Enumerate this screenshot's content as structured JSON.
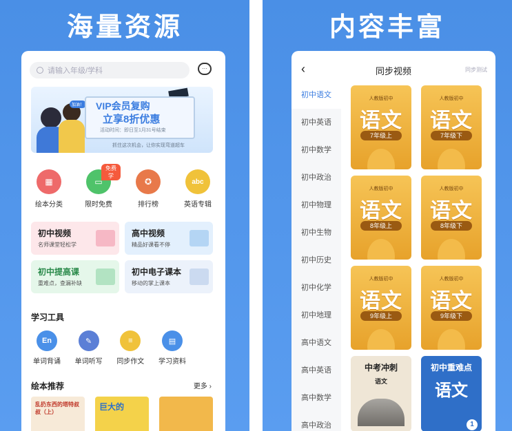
{
  "left": {
    "hero_title": "海量资源",
    "search_placeholder": "请输入年级/学科",
    "chat_icon_label": "···",
    "banner": {
      "line1": "VIP会员复购",
      "line2": "立享8折优惠",
      "line3": "活动时间：即日至1月31号结束",
      "line4": "抓住这次机会，让你实现弯道超车",
      "bubble": "加油！"
    },
    "categories": [
      {
        "label": "绘本分类",
        "color": "#ee6a6a",
        "glyph": "▦"
      },
      {
        "label": "限时免费",
        "color": "#4fc36a",
        "glyph": "▭",
        "tag": "免费学"
      },
      {
        "label": "排行榜",
        "color": "#e8794a",
        "glyph": "✪"
      },
      {
        "label": "英语专辑",
        "color": "#f0c23a",
        "glyph": "abc"
      }
    ],
    "cards": [
      {
        "title": "初中视频",
        "sub": "名师课堂轻松学",
        "bg": "#fde7ea",
        "deco": "#f08aa0"
      },
      {
        "title": "高中视频",
        "sub": "精品好课看不停",
        "bg": "#e3f0fd",
        "deco": "#86b9ec"
      },
      {
        "title": "初中提高课",
        "sub": "重难点，查漏补缺",
        "bg": "#e5f7ea",
        "deco": "#7fd09a"
      },
      {
        "title": "初中电子课本",
        "sub": "移动的掌上课本",
        "bg": "#ecf2fb",
        "deco": "#a9c1e5"
      }
    ],
    "tools_title": "学习工具",
    "tools": [
      {
        "label": "单词背诵",
        "color": "#4a90e8",
        "glyph": "En"
      },
      {
        "label": "单词听写",
        "color": "#5b7fd6",
        "glyph": "✎"
      },
      {
        "label": "同步作文",
        "color": "#f0c23a",
        "glyph": "≡"
      },
      {
        "label": "学习资料",
        "color": "#4a90e8",
        "glyph": "▤"
      }
    ],
    "books_title": "绘本推荐",
    "more": "更多 ›",
    "books": [
      {
        "title": "乱扔东西的塔特叔叔（上）",
        "bg": "#f7ead8",
        "fg": "#c0392b"
      },
      {
        "title": "巨大的",
        "bg": "#f4d24a",
        "fg": "#2a6fc9"
      },
      {
        "title": "",
        "bg": "#f2b84b",
        "fg": "#333"
      }
    ]
  },
  "right": {
    "hero_title": "内容丰富",
    "nav_title": "同步视频",
    "nav_right": "同步测试",
    "back": "‹",
    "subjects": [
      "初中语文",
      "初中英语",
      "初中数学",
      "初中政治",
      "初中物理",
      "初中生物",
      "初中历史",
      "初中化学",
      "初中地理",
      "高中语文",
      "高中英语",
      "高中数学",
      "高中政治"
    ],
    "active_subject": "初中语文",
    "covers": [
      {
        "pub": "人教版初中",
        "subject": "语文",
        "grade": "7年级上"
      },
      {
        "pub": "人教版初中",
        "subject": "语文",
        "grade": "7年级下"
      },
      {
        "pub": "人教版初中",
        "subject": "语文",
        "grade": "8年级上"
      },
      {
        "pub": "人教版初中",
        "subject": "语文",
        "grade": "8年级下"
      },
      {
        "pub": "人教版初中",
        "subject": "语文",
        "grade": "9年级上"
      },
      {
        "pub": "人教版初中",
        "subject": "语文",
        "grade": "9年级下"
      }
    ],
    "extra_covers": [
      {
        "line1": "中考冲刺",
        "line2": "语文",
        "bg": "#efe6d6",
        "fg": "#222"
      },
      {
        "line1": "初中重难点",
        "line2": "语文",
        "badge": "1",
        "bg": "#2f6fc8",
        "fg": "#fff"
      }
    ]
  }
}
